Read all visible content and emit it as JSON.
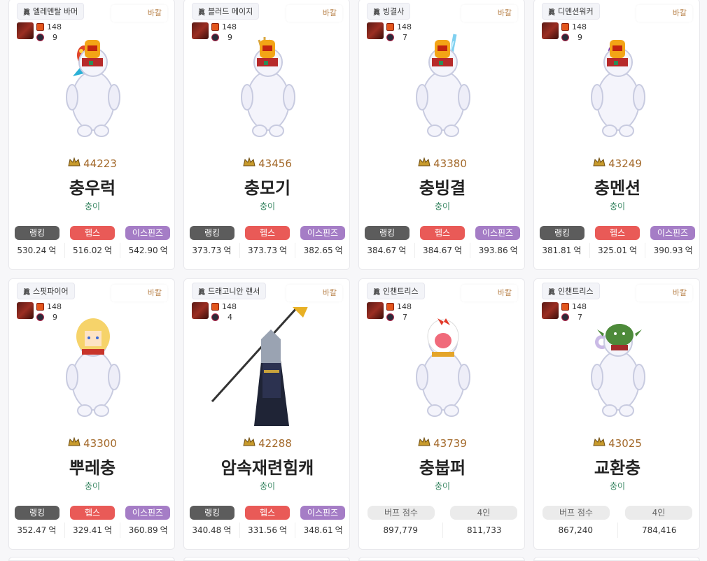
{
  "cards": [
    {
      "job": "엘레멘탈 바머",
      "server": "바칼",
      "lvl": "148",
      "sub": "9",
      "score": "44223",
      "name": "충우럭",
      "adv": "충이",
      "type": "rank",
      "b1": "랭킹",
      "b2": "헵스",
      "b3": "이스핀즈",
      "v1": "530.24",
      "v2": "516.02",
      "v3": "542.90",
      "u": "억",
      "weapon": "fish",
      "head": "helmet"
    },
    {
      "job": "블러드 메이지",
      "server": "바칼",
      "lvl": "148",
      "sub": "9",
      "score": "43456",
      "name": "충모기",
      "adv": "충이",
      "type": "rank",
      "b1": "랭킹",
      "b2": "헵스",
      "b3": "이스핀즈",
      "v1": "373.73",
      "v2": "373.73",
      "v3": "382.65",
      "u": "억",
      "weapon": "trident",
      "head": "helmet"
    },
    {
      "job": "빙결사",
      "server": "바칼",
      "lvl": "148",
      "sub": "7",
      "score": "43380",
      "name": "충빙결",
      "adv": "충이",
      "type": "rank",
      "b1": "랭킹",
      "b2": "헵스",
      "b3": "이스핀즈",
      "v1": "384.67",
      "v2": "384.67",
      "v3": "393.86",
      "u": "억",
      "weapon": "ice",
      "head": "helmet"
    },
    {
      "job": "디멘션워커",
      "server": "바칼",
      "lvl": "148",
      "sub": "9",
      "score": "43249",
      "name": "충멘션",
      "adv": "충이",
      "type": "rank",
      "b1": "랭킹",
      "b2": "헵스",
      "b3": "이스핀즈",
      "v1": "381.81",
      "v2": "325.01",
      "v3": "390.93",
      "u": "억",
      "weapon": "staff",
      "head": "helmet"
    },
    {
      "job": "스핏파이어",
      "server": "바칼",
      "lvl": "148",
      "sub": "9",
      "score": "43300",
      "name": "뿌레충",
      "adv": "충이",
      "type": "rank",
      "b1": "랭킹",
      "b2": "헵스",
      "b3": "이스핀즈",
      "v1": "352.47",
      "v2": "329.41",
      "v3": "360.89",
      "u": "억",
      "weapon": "none",
      "head": "blonde"
    },
    {
      "job": "드래고니안 랜서",
      "server": "바칼",
      "lvl": "148",
      "sub": "4",
      "score": "42288",
      "name": "암속재련힘캐",
      "adv": "충이",
      "type": "rank",
      "b1": "랭킹",
      "b2": "헵스",
      "b3": "이스핀즈",
      "v1": "340.48",
      "v2": "331.56",
      "v3": "348.61",
      "u": "억",
      "weapon": "spear",
      "head": "knight"
    },
    {
      "job": "인챈트리스",
      "server": "바칼",
      "lvl": "148",
      "sub": "7",
      "score": "43739",
      "name": "충붑퍼",
      "adv": "충이",
      "type": "buff",
      "b1": "버프 점수",
      "b2": "4인",
      "v1": "897,779",
      "v2": "811,733",
      "weapon": "none",
      "head": "chicken"
    },
    {
      "job": "인챈트리스",
      "server": "바칼",
      "lvl": "148",
      "sub": "7",
      "score": "43025",
      "name": "교환충",
      "adv": "충이",
      "type": "buff",
      "b1": "버프 점수",
      "b2": "4인",
      "v1": "867,240",
      "v2": "784,416",
      "weapon": "orb",
      "head": "goblin"
    }
  ],
  "icons": {
    "job": "jin-badge-icon",
    "score": "crown-icon",
    "face": "character-face-icon",
    "lvl": "flame-icon",
    "sub": "orb-icon"
  },
  "colors": {
    "score": "#a3692a",
    "adventure": "#3d8a66",
    "ranking": "#5c5c5c",
    "heps": "#e95a57",
    "ispins": "#a57dc6"
  }
}
